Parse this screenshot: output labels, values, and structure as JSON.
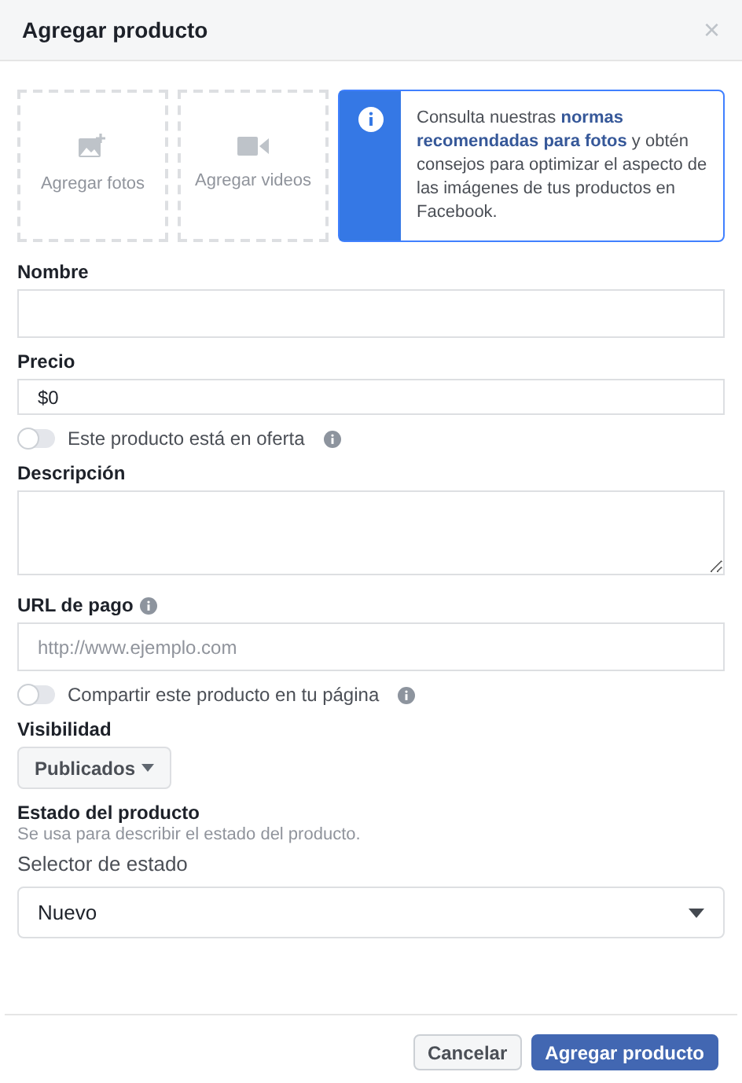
{
  "dialog": {
    "title": "Agregar producto",
    "close": "×"
  },
  "media": [
    {
      "kind": "photo",
      "label": "Agregar fotos"
    },
    {
      "kind": "video",
      "label": "Agregar videos"
    }
  ],
  "notice": {
    "text": "Consulta nuestras **normas recomendadas para fotos** y obtén consejos para optimizar el aspecto de las imágenes de tus productos en Facebook."
  },
  "fields": [
    {
      "kind": "input",
      "label": "Nombre"
    },
    {
      "kind": "input",
      "label": "Precio",
      "value": "$0"
    },
    {
      "kind": "toggle",
      "label": "Este producto está en oferta",
      "on": false
    },
    {
      "kind": "textarea",
      "label": "Descripción"
    },
    {
      "kind": "input",
      "label": "URL de pago",
      "info": true,
      "placeholder": "http://www.ejemplo.com"
    },
    {
      "kind": "toggle",
      "label": "Compartir este producto en tu página",
      "on": false
    },
    {
      "kind": "menu",
      "label": "Visibilidad",
      "value": "Publicados"
    },
    {
      "kind": "select",
      "label": "Estado del producto",
      "hint": "Se usa para describir el estado del producto.",
      "caption": "Selector de estado",
      "value": "Nuevo"
    }
  ],
  "buttons": [
    {
      "label": "Cancelar",
      "primary": false
    },
    {
      "label": "Agregar producto",
      "primary": true
    }
  ]
}
